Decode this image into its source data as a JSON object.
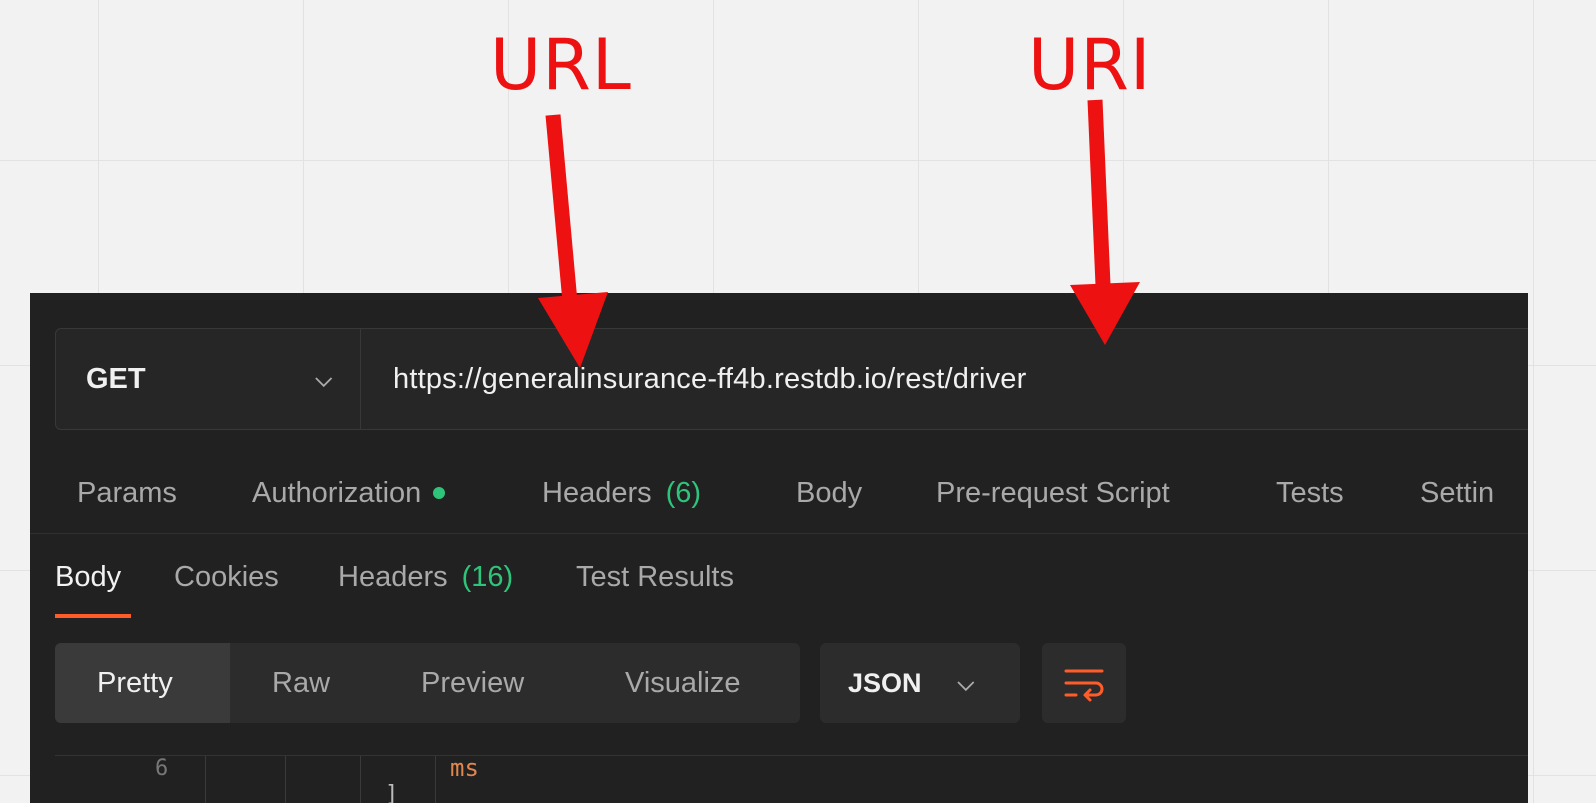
{
  "annotations": {
    "url_label": "URL",
    "uri_label": "URI",
    "color": "#ee1111"
  },
  "request": {
    "method": "GET",
    "url": "https://generalinsurance-ff4b.restdb.io/rest/driver"
  },
  "request_tabs": {
    "params": "Params",
    "authorization": "Authorization",
    "headers": "Headers",
    "headers_count": "(6)",
    "body": "Body",
    "pre_request_script": "Pre-request Script",
    "tests": "Tests",
    "settings": "Settin"
  },
  "response_tabs": {
    "body": "Body",
    "cookies": "Cookies",
    "headers": "Headers",
    "headers_count": "(16)",
    "test_results": "Test Results"
  },
  "view_modes": {
    "pretty": "Pretty",
    "raw": "Raw",
    "preview": "Preview",
    "visualize": "Visualize"
  },
  "format": {
    "selected": "JSON"
  },
  "editor": {
    "line_number": "6",
    "fragment": "ms",
    "bracket": "]"
  },
  "colors": {
    "accent": "#ff5c2a",
    "green": "#2ec57b",
    "panel_bg": "#212121"
  },
  "icons": {
    "method_dropdown": "chevron-down-icon",
    "wrap": "wrap-lines-icon"
  }
}
